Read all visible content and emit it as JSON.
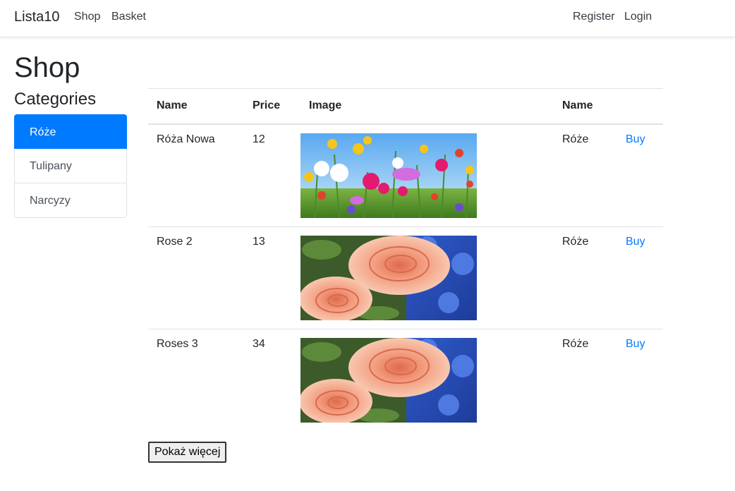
{
  "navbar": {
    "brand": "Lista10",
    "links": [
      "Shop",
      "Basket"
    ],
    "right_links": [
      "Register",
      "Login"
    ]
  },
  "page": {
    "title": "Shop",
    "categories_title": "Categories"
  },
  "categories": [
    {
      "label": "Róże",
      "active": true
    },
    {
      "label": "Tulipany",
      "active": false
    },
    {
      "label": "Narcyzy",
      "active": false
    }
  ],
  "table": {
    "headers": [
      "Name",
      "Price",
      "Image",
      "Name",
      ""
    ],
    "rows": [
      {
        "name": "Róża Nowa",
        "price": "12",
        "image": "wildflowers-photo",
        "category": "Róże",
        "action": "Buy"
      },
      {
        "name": "Rose 2",
        "price": "13",
        "image": "peach-roses-photo",
        "category": "Róże",
        "action": "Buy"
      },
      {
        "name": "Roses 3",
        "price": "34",
        "image": "peach-roses-photo",
        "category": "Róże",
        "action": "Buy"
      }
    ]
  },
  "more_button": "Pokaż więcej",
  "colors": {
    "accent": "#007bff",
    "text": "#212529",
    "border": "#dee2e6"
  }
}
